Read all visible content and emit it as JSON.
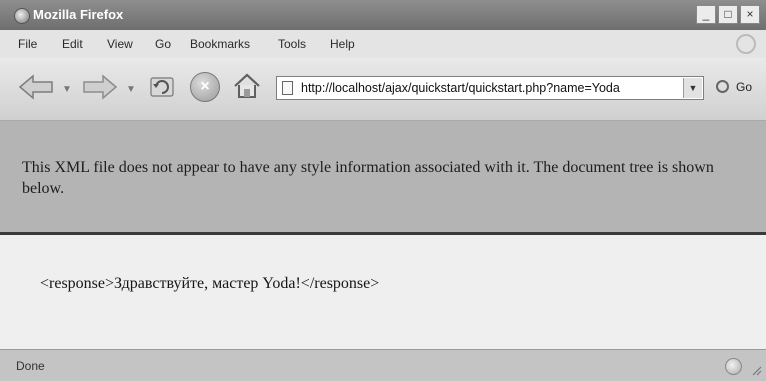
{
  "window": {
    "title": "Mozilla Firefox"
  },
  "window_controls": {
    "minimize": "_",
    "maximize": "□",
    "close": "×"
  },
  "menu": [
    "File",
    "Edit",
    "View",
    "Go",
    "Bookmarks",
    "Tools",
    "Help"
  ],
  "toolbar": {
    "url": "http://localhost/ajax/quickstart/quickstart.php?name=Yoda",
    "go_label": "Go",
    "icons": [
      "back-arrow-icon",
      "forward-arrow-icon",
      "reload-icon",
      "stop-icon",
      "home-icon",
      "page-icon",
      "go-icon"
    ]
  },
  "content": {
    "notice": "This XML file does not appear to have any style information associated with it. The document tree is shown below.",
    "xml": "<response>Здравствуйте, мастер Yoda!</response>"
  },
  "status": {
    "text": "Done"
  }
}
